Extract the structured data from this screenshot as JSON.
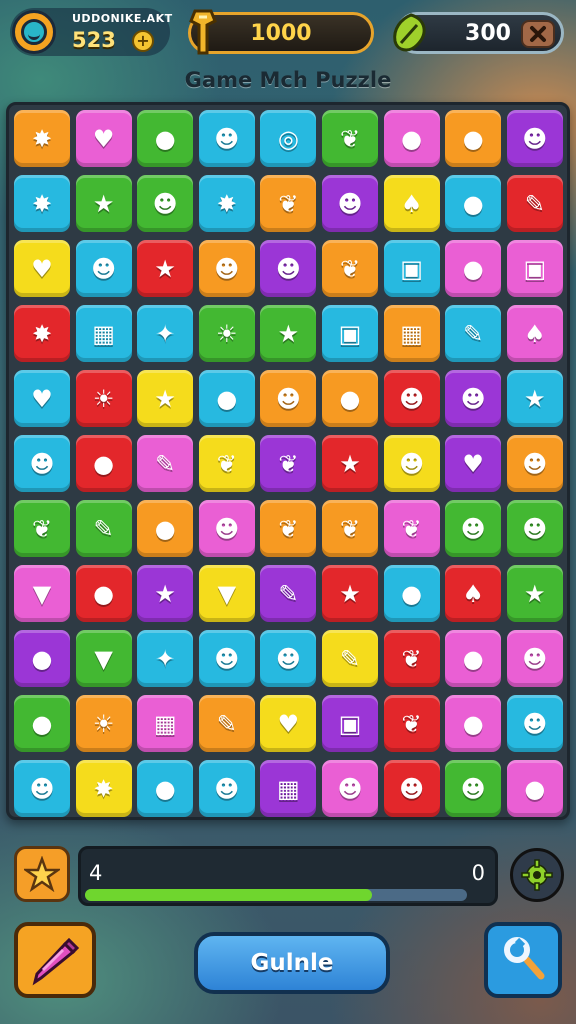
{
  "header": {
    "player_name": "UDDONIKE.AKT",
    "player_score": "523",
    "add_label": "+",
    "coins": "1000",
    "gems": "300",
    "close_label": "✕"
  },
  "title": "Game Mch Puzzle",
  "board": {
    "columns": 9,
    "rows": 11,
    "tiles": [
      [
        "orange",
        "splat"
      ],
      [
        "pink",
        "heart"
      ],
      [
        "green",
        "blob"
      ],
      [
        "cyan",
        "face"
      ],
      [
        "cyan",
        "swirl"
      ],
      [
        "green",
        "leaf"
      ],
      [
        "pink",
        "orb"
      ],
      [
        "orange",
        "orb"
      ],
      [
        "purple",
        "face"
      ],
      [
        "cyan",
        "splat"
      ],
      [
        "green",
        "star"
      ],
      [
        "green",
        "face"
      ],
      [
        "cyan",
        "splat"
      ],
      [
        "orange",
        "leaf"
      ],
      [
        "purple",
        "face"
      ],
      [
        "yellow",
        "balloon"
      ],
      [
        "cyan",
        "orb"
      ],
      [
        "red",
        "pencil"
      ],
      [
        "yellow",
        "heart"
      ],
      [
        "cyan",
        "face"
      ],
      [
        "red",
        "star"
      ],
      [
        "orange",
        "face"
      ],
      [
        "purple",
        "face"
      ],
      [
        "orange",
        "leaf"
      ],
      [
        "cyan",
        "card"
      ],
      [
        "pink",
        "orb"
      ],
      [
        "pink",
        "card"
      ],
      [
        "red",
        "splat"
      ],
      [
        "cyan",
        "gift"
      ],
      [
        "cyan",
        "wand"
      ],
      [
        "green",
        "sun"
      ],
      [
        "green",
        "star"
      ],
      [
        "cyan",
        "card"
      ],
      [
        "orange",
        "gift"
      ],
      [
        "cyan",
        "pencil"
      ],
      [
        "pink",
        "balloon"
      ],
      [
        "cyan",
        "heart"
      ],
      [
        "red",
        "sun"
      ],
      [
        "yellow",
        "star"
      ],
      [
        "cyan",
        "orb"
      ],
      [
        "orange",
        "face"
      ],
      [
        "orange",
        "orb"
      ],
      [
        "red",
        "face"
      ],
      [
        "purple",
        "face"
      ],
      [
        "cyan",
        "star"
      ],
      [
        "cyan",
        "face"
      ],
      [
        "red",
        "orb"
      ],
      [
        "pink",
        "pencil"
      ],
      [
        "yellow",
        "leaf"
      ],
      [
        "purple",
        "leaf"
      ],
      [
        "red",
        "star"
      ],
      [
        "yellow",
        "face"
      ],
      [
        "purple",
        "heart"
      ],
      [
        "orange",
        "face"
      ],
      [
        "green",
        "leaf"
      ],
      [
        "green",
        "pencil"
      ],
      [
        "orange",
        "orb"
      ],
      [
        "pink",
        "face"
      ],
      [
        "orange",
        "leaf"
      ],
      [
        "orange",
        "leaf"
      ],
      [
        "pink",
        "leaf"
      ],
      [
        "green",
        "face"
      ],
      [
        "green",
        "face"
      ],
      [
        "pink",
        "cone"
      ],
      [
        "red",
        "orb"
      ],
      [
        "purple",
        "star"
      ],
      [
        "yellow",
        "cone"
      ],
      [
        "purple",
        "pencil"
      ],
      [
        "red",
        "star"
      ],
      [
        "cyan",
        "orb"
      ],
      [
        "red",
        "balloon"
      ],
      [
        "green",
        "star"
      ],
      [
        "purple",
        "orb"
      ],
      [
        "green",
        "cone"
      ],
      [
        "cyan",
        "wand"
      ],
      [
        "cyan",
        "face"
      ],
      [
        "cyan",
        "face"
      ],
      [
        "yellow",
        "pencil"
      ],
      [
        "red",
        "leaf"
      ],
      [
        "pink",
        "orb"
      ],
      [
        "pink",
        "face"
      ],
      [
        "green",
        "blob"
      ],
      [
        "orange",
        "sun"
      ],
      [
        "pink",
        "gift"
      ],
      [
        "orange",
        "pencil"
      ],
      [
        "yellow",
        "heart"
      ],
      [
        "purple",
        "card"
      ],
      [
        "red",
        "leaf"
      ],
      [
        "pink",
        "orb"
      ],
      [
        "cyan",
        "face"
      ],
      [
        "cyan",
        "face"
      ],
      [
        "yellow",
        "splat"
      ],
      [
        "cyan",
        "blob"
      ],
      [
        "cyan",
        "face"
      ],
      [
        "purple",
        "gift"
      ],
      [
        "pink",
        "face"
      ],
      [
        "red",
        "face"
      ],
      [
        "green",
        "face"
      ],
      [
        "pink",
        "orb"
      ]
    ]
  },
  "colors": {
    "orange": "#f79a22",
    "pink": "#ea5fd4",
    "green": "#43b832",
    "cyan": "#27b9e0",
    "purple": "#9b36d6",
    "yellow": "#f5dc1c",
    "red": "#e3272b"
  },
  "icons": {
    "splat": "✸",
    "heart": "♥",
    "blob": "●",
    "face": "☻",
    "swirl": "◎",
    "leaf": "❦",
    "orb": "●",
    "star": "★",
    "balloon": "♠",
    "pencil": "✎",
    "card": "▣",
    "gift": "▦",
    "wand": "✦",
    "sun": "☀",
    "cone": "▼"
  },
  "bottom": {
    "progress_left": "4",
    "progress_right": "0",
    "progress_fraction": 0.75,
    "guide_label": "Gulnle"
  }
}
